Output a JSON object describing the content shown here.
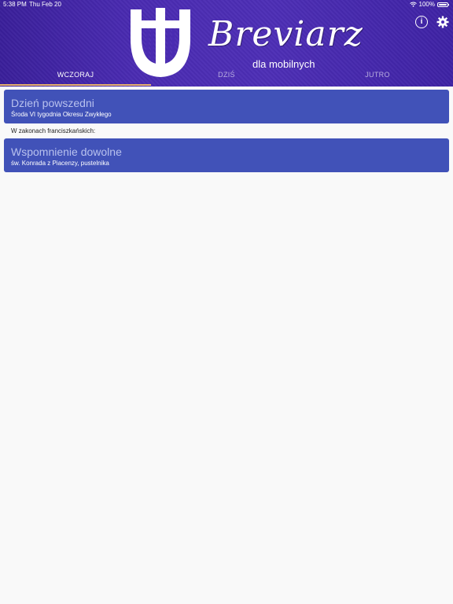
{
  "status": {
    "time": "5:38 PM",
    "date": "Thu Feb 20",
    "battery": "100%"
  },
  "brand": {
    "title": "Breviarz",
    "subtitle": "dla mobilnych"
  },
  "tabs": [
    {
      "label": "WCZORAJ",
      "active": true
    },
    {
      "label": "DZIŚ",
      "active": false
    },
    {
      "label": "JUTRO",
      "active": false
    }
  ],
  "cards": [
    {
      "title": "Dzień powszedni",
      "subtitle": "Środa VI tygodnia Okresu Zwykłego"
    },
    {
      "title": "Wspomnienie dowolne",
      "subtitle": "św. Konrada z Piacenzy, pustelnika"
    }
  ],
  "section": {
    "label": "W zakonach franciszkańskich:"
  },
  "icons": {
    "info": "info-icon",
    "settings": "gear-icon"
  },
  "colors": {
    "header": "#4a2bb2",
    "card": "#4152b8",
    "tab_indicator": "#e9b36a"
  }
}
